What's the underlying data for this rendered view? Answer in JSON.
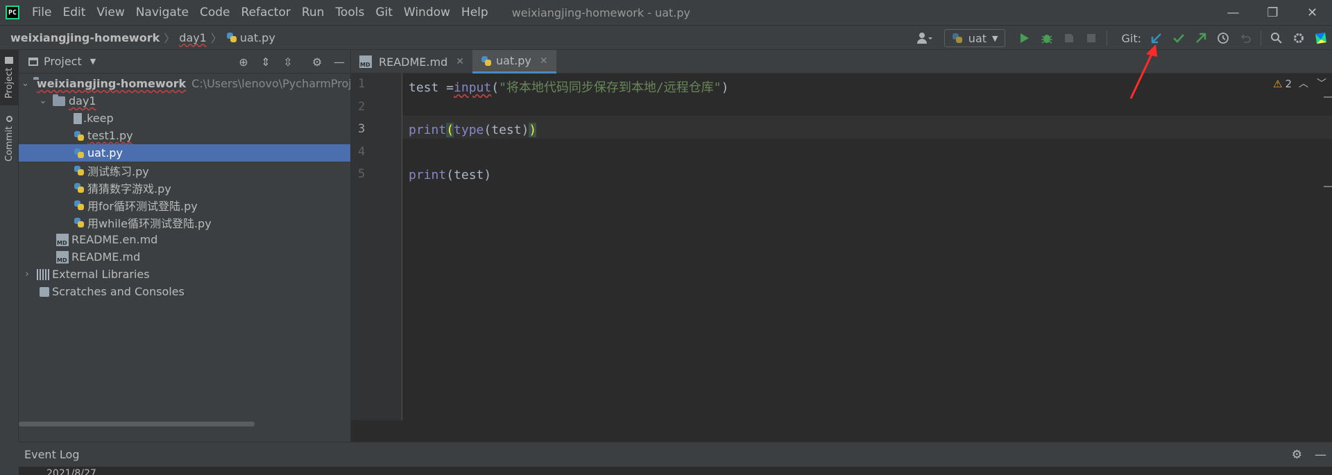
{
  "menubar": {
    "logo": "PC",
    "items": [
      "File",
      "Edit",
      "View",
      "Navigate",
      "Code",
      "Refactor",
      "Run",
      "Tools",
      "Git",
      "Window",
      "Help"
    ],
    "window_title": "weixiangjing-homework - uat.py",
    "controls": {
      "minimize": "—",
      "restore": "❐",
      "close": "✕"
    }
  },
  "navbar": {
    "breadcrumbs": [
      "weixiangjing-homework",
      "day1",
      "uat.py"
    ],
    "run_config": "uat",
    "git_label": "Git:",
    "icons": [
      "user-icon",
      "run-icon",
      "debug-icon",
      "coverage-icon",
      "stop-icon",
      "git-update-icon",
      "git-commit-icon",
      "git-push-icon",
      "history-icon",
      "rollback-icon",
      "search-icon",
      "settings-icon",
      "logo-icon"
    ]
  },
  "side_tabs": {
    "project": "Project",
    "commit": "Commit"
  },
  "project_panel": {
    "title": "Project",
    "tree": [
      {
        "label": "weixiangjing-homework",
        "hint": "C:\\Users\\lenovo\\PycharmProjec",
        "type": "folder",
        "level": 0,
        "expanded": true,
        "bold": true
      },
      {
        "label": "day1",
        "type": "folder",
        "level": 1,
        "expanded": true
      },
      {
        "label": ".keep",
        "type": "file",
        "level": 2
      },
      {
        "label": "test1.py",
        "type": "py",
        "level": 2
      },
      {
        "label": "uat.py",
        "type": "py",
        "level": 2,
        "selected": true
      },
      {
        "label": "测试练习.py",
        "type": "py",
        "level": 2
      },
      {
        "label": "猜猜数字游戏.py",
        "type": "py",
        "level": 2
      },
      {
        "label": "用for循环测试登陆.py",
        "type": "py",
        "level": 2
      },
      {
        "label": "用while循环测试登陆.py",
        "type": "py",
        "level": 2
      },
      {
        "label": "README.en.md",
        "type": "md",
        "level": 1
      },
      {
        "label": "README.md",
        "type": "md",
        "level": 1
      },
      {
        "label": "External Libraries",
        "type": "lib",
        "level": 0,
        "expanded": false
      },
      {
        "label": "Scratches and Consoles",
        "type": "scratch",
        "level": 0
      }
    ]
  },
  "editor": {
    "tabs": [
      {
        "label": "README.md",
        "active": false
      },
      {
        "label": "uat.py",
        "active": true
      }
    ],
    "line_numbers": [
      "1",
      "2",
      "3",
      "4",
      "5"
    ],
    "current_line": 3,
    "warnings": "2",
    "code": {
      "line1": {
        "a": "test =",
        "b": "input",
        "c": "(",
        "d": "\"将本地代码同步保存到本地/远程仓库\"",
        "e": ")"
      },
      "line3": {
        "a": "print",
        "b": "(",
        "c": "type",
        "d": "(test)",
        "e": ")"
      },
      "line5": {
        "a": "print",
        "b": "(test)"
      }
    }
  },
  "event_log": {
    "title": "Event Log",
    "date": "2021/8/27"
  },
  "colors": {
    "accent": "#4b6eaf",
    "annotation_arrow": "#ff2a2a",
    "run_green": "#499c54",
    "git_blue": "#3592c4"
  }
}
